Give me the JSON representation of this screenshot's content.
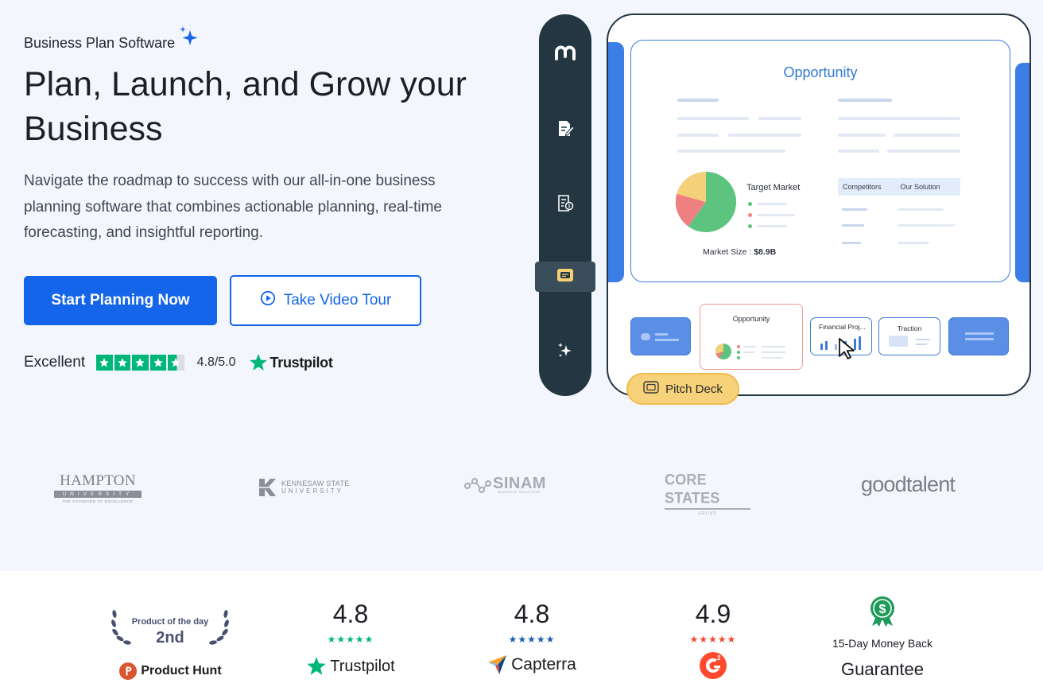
{
  "hero": {
    "eyebrow": "Business Plan Software",
    "headline": "Plan, Launch, and Grow your Business",
    "subheadline": "Navigate the roadmap to success with our all-in-one business planning software that combines actionable planning, real-time forecasting, and insightful reporting.",
    "primary_cta": "Start Planning Now",
    "secondary_cta": "Take Video Tour",
    "rating_label": "Excellent",
    "rating_score": "4.8/5.0",
    "rating_brand": "Trustpilot"
  },
  "app_preview": {
    "doc_title": "Opportunity",
    "target_market_label": "Target Market",
    "market_size_label": "Market Size : ",
    "market_size_value": "$8.9B",
    "competitors_label": "Competitors",
    "our_solution_label": "Our Solution",
    "thumb_opportunity": "Opportunity",
    "thumb_financial": "Financial Proj...",
    "thumb_traction": "Traction",
    "pitch_deck_tag": "Pitch Deck",
    "pie_colors": [
      "#5cc47f",
      "#ef8080",
      "#f3d07a"
    ]
  },
  "logos": {
    "hampton_name": "HAMPTON",
    "hampton_sub": "UNIVERSITY",
    "hampton_tag": "THE STANDARD OF EXCELLENCE",
    "kennesaw_line1": "KENNESAW STATE",
    "kennesaw_line2": "UNIVERSITY",
    "sinam": "SINAM",
    "sinam_sub": "BUSINESS SOLUTIONS",
    "core_states": "CORE STATES",
    "core_states_sub": "GROUP",
    "goodtalent": "goodtalent"
  },
  "awards": {
    "product_hunt_title": "Product of the day",
    "product_hunt_rank": "2nd",
    "product_hunt_brand": "Product Hunt",
    "trustpilot_score": "4.8",
    "trustpilot_brand": "Trustpilot",
    "capterra_score": "4.8",
    "capterra_brand": "Capterra",
    "g2_score": "4.9",
    "money_back_line1": "15-Day Money Back",
    "money_back_line2": "Guarantee"
  },
  "colors": {
    "primary": "#1565ea",
    "trustpilot_green": "#00b67a",
    "capterra_blue": "#1a5ea8",
    "g2_red": "#ec4b34",
    "guarantee_green": "#1f9a5a"
  }
}
